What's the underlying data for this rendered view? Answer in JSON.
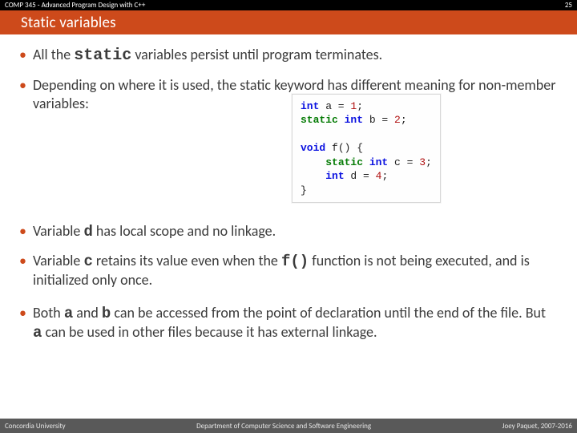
{
  "topbar": {
    "course": "COMP 345 - Advanced Program Design with C++",
    "page": "25"
  },
  "title": "Static variables",
  "bullets": {
    "b1_pre": "All the ",
    "b1_kw": "static",
    "b1_post": " variables persist until program terminates.",
    "b2": "Depending on where it is used, the static keyword has different meaning for non-member variables:",
    "b3_pre": "Variable ",
    "b3_var": "d",
    "b3_post": " has local scope and no linkage.",
    "b4_pre": "Variable ",
    "b4_var": "c",
    "b4_mid": " retains its value even when the ",
    "b4_fn": "f()",
    "b4_post": " function is not being executed, and is initialized only once.",
    "b5_pre": "Both ",
    "b5_a": "a",
    "b5_and": " and ",
    "b5_b": "b",
    "b5_mid": " can be accessed from the point of declaration until the end of the file. But ",
    "b5_a2": "a",
    "b5_post": " can be used in other files because it has external linkage."
  },
  "code": {
    "l1_t": "int",
    "l1_r": " a = ",
    "l1_n": "1",
    "l1_s": ";",
    "l2_s": "static",
    "l2_t": " int",
    "l2_r": " b = ",
    "l2_n": "2",
    "l2_e": ";",
    "blank": " ",
    "l4_v": "void",
    "l4_r": " f() {",
    "l5_pad": "    ",
    "l5_s": "static",
    "l5_t": " int",
    "l5_r": " c = ",
    "l5_n": "3",
    "l5_e": ";",
    "l6_pad": "    ",
    "l6_t": "int",
    "l6_r": " d = ",
    "l6_n": "4",
    "l6_e": ";",
    "l7": "}"
  },
  "footer": {
    "left": "Concordia University",
    "center": "Department of Computer Science and Software Engineering",
    "right": "Joey Paquet, 2007-2016"
  }
}
